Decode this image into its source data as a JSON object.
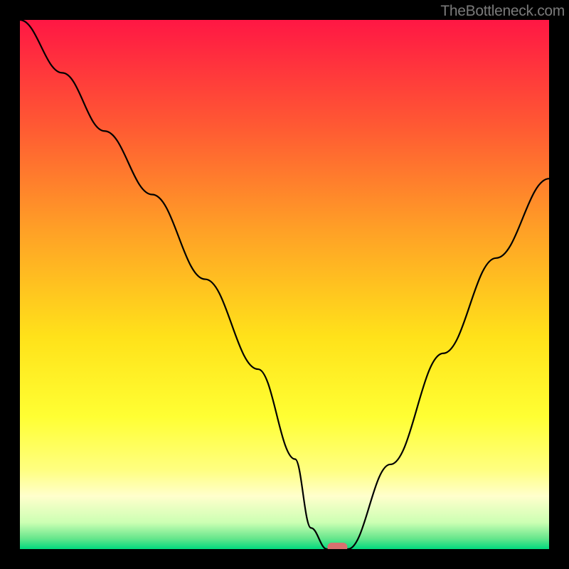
{
  "watermark": "TheBottleneck.com",
  "chart_data": {
    "type": "line",
    "title": "",
    "xlabel": "",
    "ylabel": "",
    "xlim": [
      0,
      100
    ],
    "ylim": [
      0,
      100
    ],
    "series": [
      {
        "name": "bottleneck-curve",
        "x": [
          0,
          8,
          16,
          25,
          35,
          45,
          52,
          55,
          58,
          60,
          62,
          70,
          80,
          90,
          100
        ],
        "y": [
          100,
          90,
          79,
          67,
          51,
          34,
          17,
          4,
          0,
          0,
          0,
          16,
          37,
          55,
          70
        ]
      }
    ],
    "marker": {
      "x": 60,
      "y": 0,
      "label": "optimal-point"
    },
    "background": {
      "type": "vertical-gradient",
      "description": "100% bottleneck at top (red) to 0% bottleneck at bottom (green)",
      "stops": [
        {
          "position": 0,
          "color": "#ff1744"
        },
        {
          "position": 20,
          "color": "#ff5933"
        },
        {
          "position": 40,
          "color": "#ffa126"
        },
        {
          "position": 60,
          "color": "#ffe21a"
        },
        {
          "position": 75,
          "color": "#ffff33"
        },
        {
          "position": 85,
          "color": "#ffff80"
        },
        {
          "position": 90,
          "color": "#ffffcc"
        },
        {
          "position": 95,
          "color": "#ccffb3"
        },
        {
          "position": 98,
          "color": "#66e68c"
        },
        {
          "position": 100,
          "color": "#00d97e"
        }
      ]
    }
  }
}
